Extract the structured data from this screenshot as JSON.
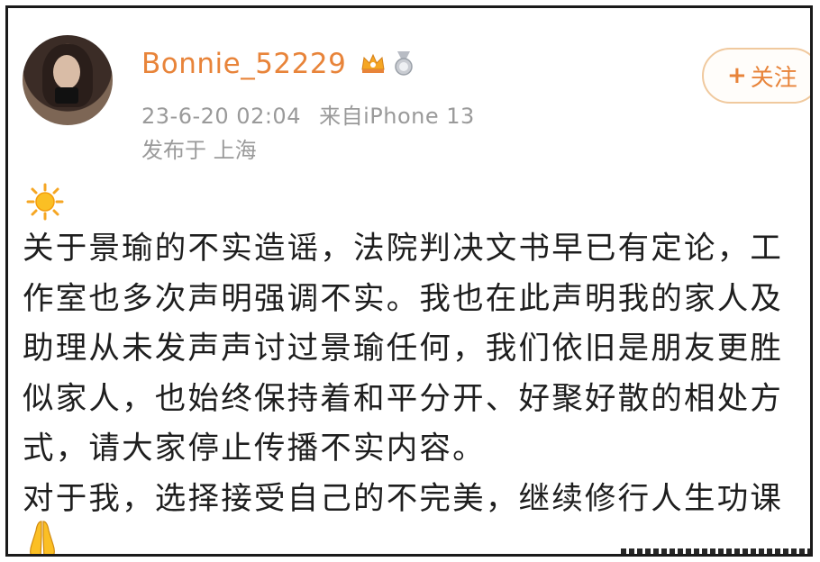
{
  "post": {
    "username": "Bonnie_52229",
    "timestamp": "23-6-20 02:04",
    "source": "来自iPhone 13",
    "location": "发布于 上海",
    "follow_label": "关注",
    "follow_plus": "+",
    "icons": {
      "avatar": "avatar",
      "crown": "crown-badge-icon",
      "medal": "medal-badge-icon",
      "sun": "sun-emoji-icon",
      "pray": "praying-hands-emoji-icon"
    },
    "lines": [
      " 关于景瑜的不实造谣，法院判决文书早已有定论，工",
      "作室也多次声明强调不实。我也在此声明我的家人及",
      "助理从未发声声讨过景瑜任何，我们依旧是朋友更胜",
      "似家人，也始终保持着和平分开、好聚好散的相处方",
      "式，请大家停止传播不实内容。",
      " 对于我，选择接受自己的不完美，继续修行人生功课"
    ]
  },
  "colors": {
    "username": "#e8843a",
    "meta": "#9a9a9a",
    "follow_border": "#f0c99e",
    "body_text": "#1e1e1e"
  }
}
